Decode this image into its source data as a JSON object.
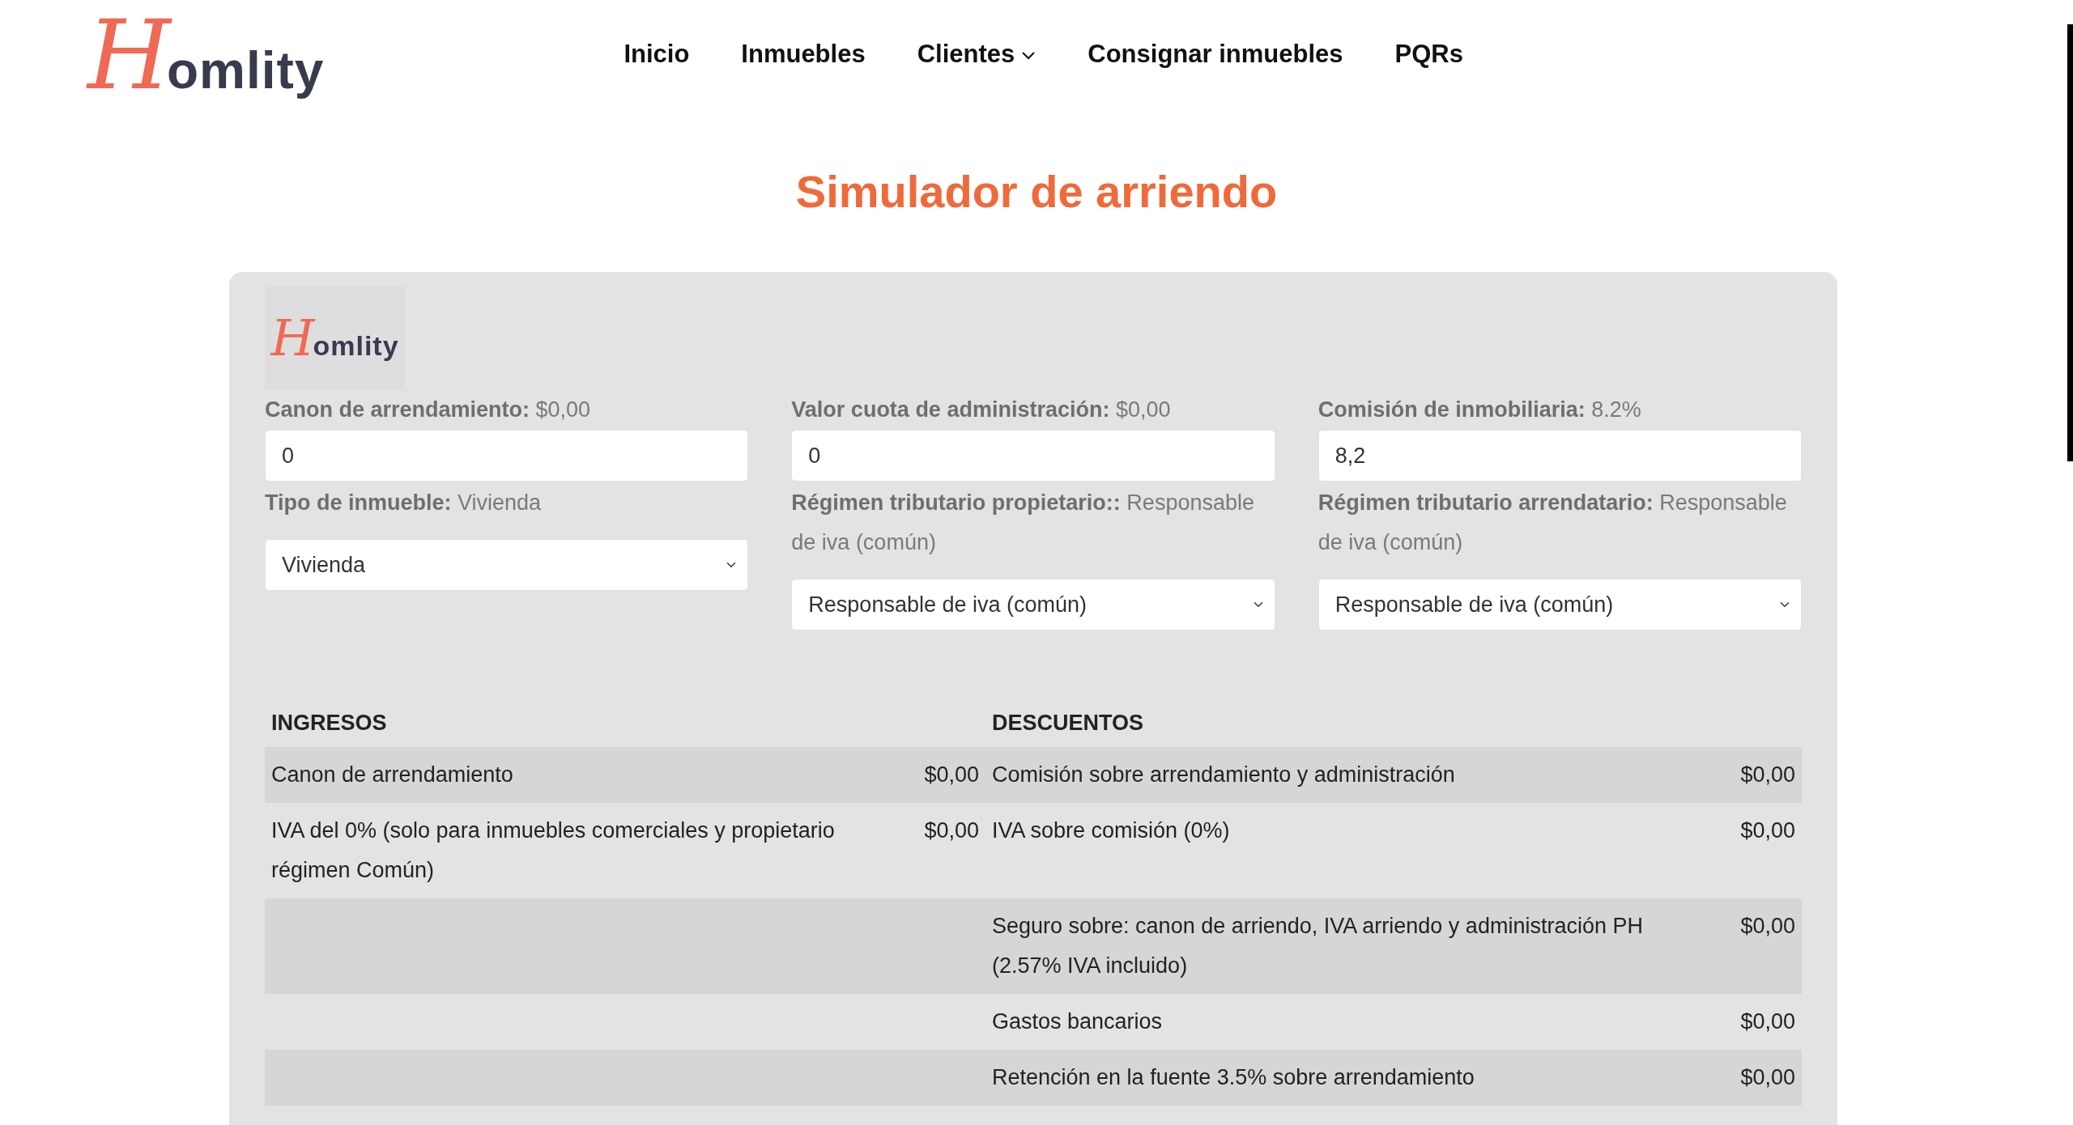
{
  "header": {
    "logo": {
      "mark": "H",
      "text": "omlity"
    },
    "nav": [
      {
        "label": "Inicio",
        "has_menu": false
      },
      {
        "label": "Inmuebles",
        "has_menu": false
      },
      {
        "label": "Clientes",
        "has_menu": true
      },
      {
        "label": "Consignar inmuebles",
        "has_menu": false
      },
      {
        "label": "PQRs",
        "has_menu": false
      }
    ]
  },
  "title": "Simulador de arriendo",
  "simulator": {
    "logo": {
      "mark": "H",
      "text": "omlity"
    },
    "columns": [
      [
        {
          "kind": "input",
          "label": "Canon de arrendamiento:",
          "current": "$0,00",
          "value": "0"
        },
        {
          "kind": "select",
          "label": "Tipo de inmueble:",
          "current": "Vivienda",
          "value": "Vivienda"
        }
      ],
      [
        {
          "kind": "input",
          "label": "Valor cuota de administración:",
          "current": "$0,00",
          "value": "0"
        },
        {
          "kind": "select",
          "label": "Régimen tributario propietario::",
          "current": "Responsable de iva (común)",
          "value": "Responsable de iva (común)"
        }
      ],
      [
        {
          "kind": "input",
          "label": "Comisión de inmobiliaria:",
          "current": "8.2%",
          "value": "8,2"
        },
        {
          "kind": "select",
          "label": "Régimen tributario arrendatario:",
          "current": "Responsable de iva (común)",
          "value": "Responsable de iva (común)"
        }
      ]
    ],
    "table": {
      "columns": [
        "INGRESOS",
        "DESCUENTOS"
      ],
      "rows": [
        {
          "income": "Canon de arrendamiento",
          "income_amount": "$0,00",
          "discount": "Comisión sobre arrendamiento y administración",
          "discount_amount": "$0,00"
        },
        {
          "income": "IVA del 0% (solo para inmuebles comerciales y propietario régimen Común)",
          "income_amount": "$0,00",
          "discount": "IVA sobre comisión (0%)",
          "discount_amount": "$0,00"
        },
        {
          "discount": "Seguro sobre: canon de arriendo, IVA arriendo y administración PH (2.57% IVA incluido)",
          "discount_amount": "$0,00"
        },
        {
          "discount": "Gastos bancarios",
          "discount_amount": "$0,00"
        },
        {
          "discount": "Retención en la fuente 3.5% sobre arrendamiento",
          "discount_amount": "$0,00"
        }
      ]
    }
  }
}
